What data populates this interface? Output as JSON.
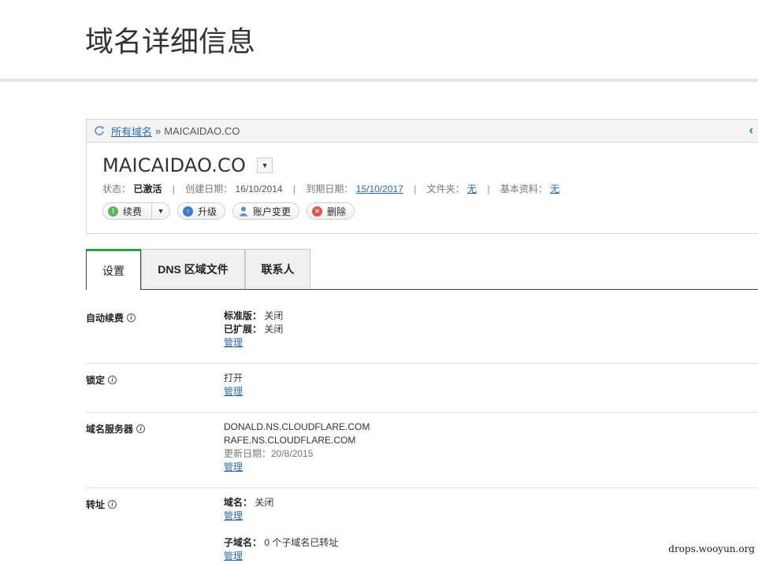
{
  "page": {
    "title": "域名详细信息"
  },
  "breadcrumb": {
    "all_domains": "所有域名",
    "separator": "»",
    "current": "MAICAIDAO.CO"
  },
  "domain": {
    "name": "MAICAIDAO.CO",
    "status_label": "状态：",
    "status_value": "已激活",
    "created_label": "创建日期：",
    "created_value": "16/10/2014",
    "expiry_label": "到期日期：",
    "expiry_value": "15/10/2017",
    "folder_label": "文件夹：",
    "folder_value": "无",
    "profile_label": "基本资料：",
    "profile_value": "无",
    "divider": "|"
  },
  "actions": {
    "renew": "续费",
    "upgrade": "升级",
    "change_account": "账户变更",
    "delete": "删除"
  },
  "tabs": [
    {
      "label": "设置"
    },
    {
      "label": "DNS 区域文件"
    },
    {
      "label": "联系人"
    }
  ],
  "settings": {
    "auto_renew": {
      "label": "自动续费",
      "standard_key": "标准版：",
      "standard_val": "关闭",
      "extended_key": "已扩展：",
      "extended_val": "关闭",
      "manage": "管理"
    },
    "lock": {
      "label": "锁定",
      "value": "打开",
      "manage": "管理"
    },
    "nameservers": {
      "label": "域名服务器",
      "ns1": "DONALD.NS.CLOUDFLARE.COM",
      "ns2": "RAFE.NS.CLOUDFLARE.COM",
      "updated": "更新日期：20/8/2015",
      "manage": "管理"
    },
    "forwarding": {
      "label": "转址",
      "domain_key": "域名：",
      "domain_val": "关闭",
      "manage": "管理",
      "subdomain_key": "子域名：",
      "subdomain_val": "0 个子域名已转址",
      "manage2": "管理"
    }
  },
  "watermark": "drops.wooyun.org",
  "colors": {
    "link": "#2c6aa8",
    "active_tab": "#2e9a4a",
    "renew_icon": "#5cb85c",
    "upgrade_icon": "#3a7fc1",
    "delete_icon": "#d9534f"
  }
}
